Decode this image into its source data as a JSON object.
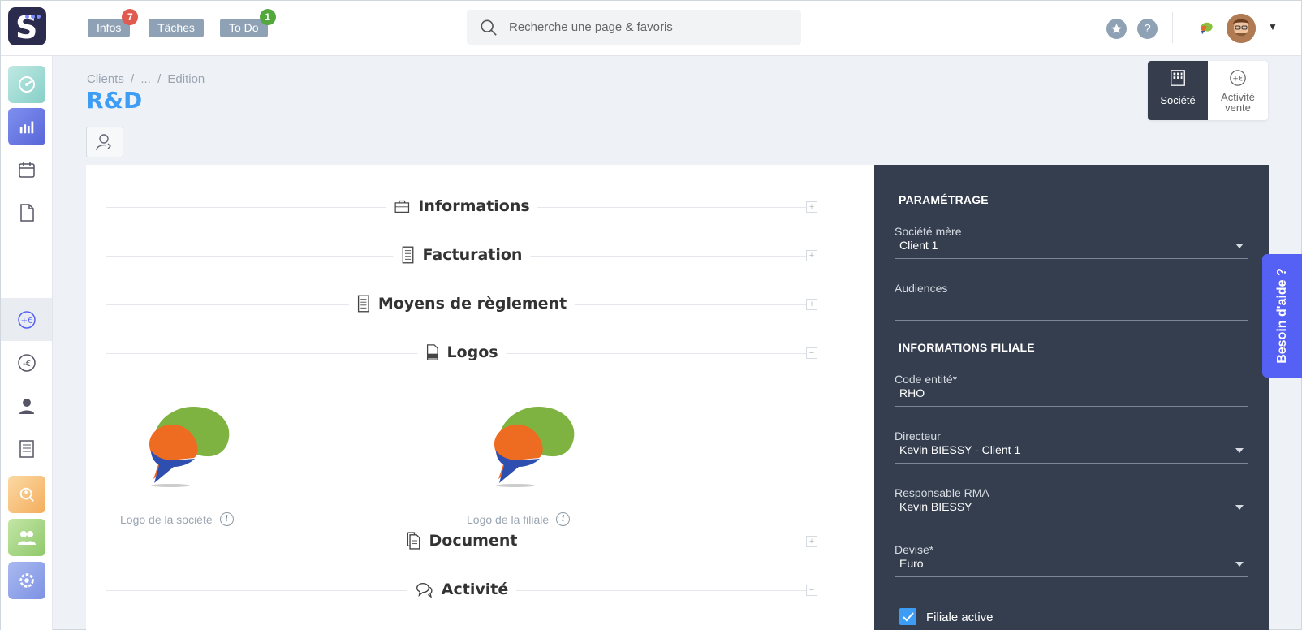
{
  "topbar": {
    "nav": [
      {
        "label": "Infos",
        "badge": "7",
        "badge_color": "#e05a4f"
      },
      {
        "label": "Tâches",
        "badge": null
      },
      {
        "label": "To Do",
        "badge": "1",
        "badge_color": "#52a83c"
      }
    ],
    "search_placeholder": "Recherche une page & favoris",
    "star_icon": "star-icon",
    "help_icon": "?",
    "user_menu_caret": "▼"
  },
  "sidebar": {
    "items": [
      {
        "icon": "dashboard-icon",
        "color": "#9fd9d3"
      },
      {
        "icon": "bar-chart-icon",
        "color": "#6c7be8"
      },
      {
        "icon": "calendar-icon",
        "color": null
      },
      {
        "icon": "file-icon",
        "color": null
      },
      {
        "icon": "euro-plus-icon",
        "color": null,
        "active": true
      },
      {
        "icon": "euro-minus-icon",
        "color": null
      },
      {
        "icon": "person-icon",
        "color": null
      },
      {
        "icon": "invoice-icon",
        "color": null
      },
      {
        "icon": "search-person-icon",
        "color": "#f8c27c"
      },
      {
        "icon": "group-icon",
        "color": "#a9d68a"
      },
      {
        "icon": "settings-icon",
        "color": "#8fa4e8"
      }
    ]
  },
  "breadcrumb": [
    "Clients",
    "/",
    "...",
    "/",
    "Edition"
  ],
  "page_title": "R&D",
  "view_toggle": {
    "societe": "Société",
    "activite_line1": "Activité",
    "activite_line2": "vente"
  },
  "sections": {
    "informations": "Informations",
    "facturation": "Facturation",
    "moyens": "Moyens de règlement",
    "logos": "Logos",
    "document": "Document",
    "activite": "Activité"
  },
  "logos": {
    "societe_caption": "Logo de la société",
    "filiale_caption": "Logo de la filiale"
  },
  "panel": {
    "parametrage_title": "PARAMÉTRAGE",
    "societe_mere_label": "Société mère",
    "societe_mere_value": "Client 1",
    "audiences_label": "Audiences",
    "audiences_value": "",
    "filiale_title": "INFORMATIONS FILIALE",
    "code_label": "Code entité*",
    "code_value": "RHO",
    "directeur_label": "Directeur",
    "directeur_value": "Kevin BIESSY - Client 1",
    "rma_label": "Responsable RMA",
    "rma_value": "Kevin BIESSY",
    "devise_label": "Devise*",
    "devise_value": "Euro",
    "filiale_active_label": "Filiale active",
    "filiale_active": true
  },
  "help_tab": "Besoin d'aide ?"
}
